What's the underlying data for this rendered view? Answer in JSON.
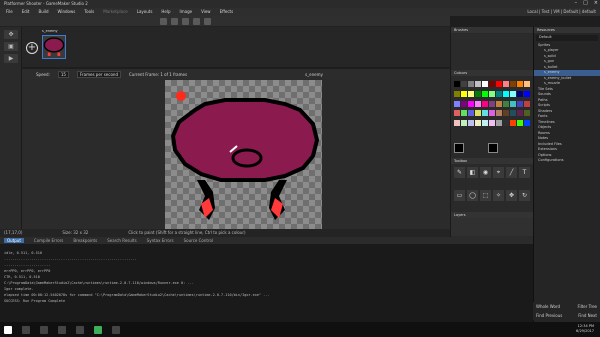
{
  "window": {
    "title": "Platformer Shooter - GameMaker Studio 2"
  },
  "menu": [
    "File",
    "Edit",
    "Build",
    "Windows",
    "Tools",
    "Marketplace",
    "Layouts",
    "Help",
    "Image",
    "View",
    "Effects"
  ],
  "menu_right": "Local | Test | VM | Default | default",
  "frame_strip": {
    "sprite_name": "s_enemy",
    "frame_index": "0"
  },
  "speed_bar": {
    "speed_label": "Speed:",
    "speed_value": "15",
    "speed_unit": "Frames per second",
    "current_frame": "Current Frame: 1 of 1 frames",
    "sprite_name": "s_enemy"
  },
  "statusbar": {
    "coords": "(17,17,0)",
    "size": "Size: 32 x 32",
    "hint": "Click to paint (Shift for a straight line, Ctrl to pick a colour)"
  },
  "panels": {
    "brushes": "Brushes",
    "colours": "Colours",
    "toolbox": "Toolbox",
    "layers": "Layers"
  },
  "resources": {
    "title": "Resources",
    "filter": "Default",
    "items": [
      "Sprites",
      "s_player",
      "s_solid",
      "s_gun",
      "s_bullet",
      "s_enemy",
      "s_enemy_bullet",
      "s_muzzle",
      "Tile Sets",
      "Sounds",
      "Paths",
      "Scripts",
      "Shaders",
      "Fonts",
      "Timelines",
      "Objects",
      "Rooms",
      "Notes",
      "Included Files",
      "Extensions",
      "Options",
      "Configurations"
    ],
    "selected_index": 5,
    "find_buttons": [
      "Whole Word",
      "Filter Tree",
      "Find Previous",
      "Find Next"
    ]
  },
  "output": {
    "tabs": [
      "Output",
      "Compile Errors",
      "Breakpoints",
      "Search Results",
      "Syntax Errors",
      "Source Control"
    ],
    "lines": [
      "idle, 0.511, 0.510",
      "...............................................................",
      "......................",
      "errPP0, errPP0, errPP0",
      "CTR, 0.511, 0.510",
      "",
      "C:\\ProgramData\\GameMakerStudio2\\Cache\\runtimes\\runtime-2.0.7.110/windows/Runner.exe 0: ...",
      "Igor complete.",
      "elapsed time 00:00:12.5402078s for command \"C:\\ProgramData\\GameMakerStudio2\\Cache\\runtimes\\runtime-2.0.7.110/bin/Igor.exe\" ...",
      "SUCCESS: Run Program Complete"
    ]
  },
  "clock": {
    "time": "12:34 PM",
    "date": "6/29/2017"
  },
  "palette": [
    "#000000",
    "#404040",
    "#808080",
    "#c0c0c0",
    "#ffffff",
    "#800000",
    "#ff0000",
    "#ff8080",
    "#804000",
    "#ff8000",
    "#ffc080",
    "#808000",
    "#ffff00",
    "#ffff80",
    "#008000",
    "#00ff00",
    "#80ff80",
    "#008080",
    "#00ffff",
    "#80ffff",
    "#000080",
    "#0000ff",
    "#8080ff",
    "#800080",
    "#ff00ff",
    "#ff80ff",
    "#ff0080",
    "#804080",
    "#c08040",
    "#408040",
    "#40c0c0",
    "#4040c0",
    "#c04040",
    "#e06060",
    "#60e060",
    "#6060e0",
    "#e0e060",
    "#60e0e0",
    "#e060e0",
    "#b08060",
    "#604020",
    "#205060",
    "#602050",
    "#506020",
    "#f0c0c0",
    "#c0f0c0",
    "#c0c0f0",
    "#f0f0c0",
    "#c0f0f0",
    "#f0c0f0",
    "#a0a0a0",
    "#303030",
    "#ff4000",
    "#40ff00",
    "#0040ff"
  ],
  "colors": {
    "sprite_body": "#8b1a4f",
    "sprite_outline": "#000000",
    "sprite_feet": "#ff3a3a",
    "accent": "#3e6ea8"
  }
}
